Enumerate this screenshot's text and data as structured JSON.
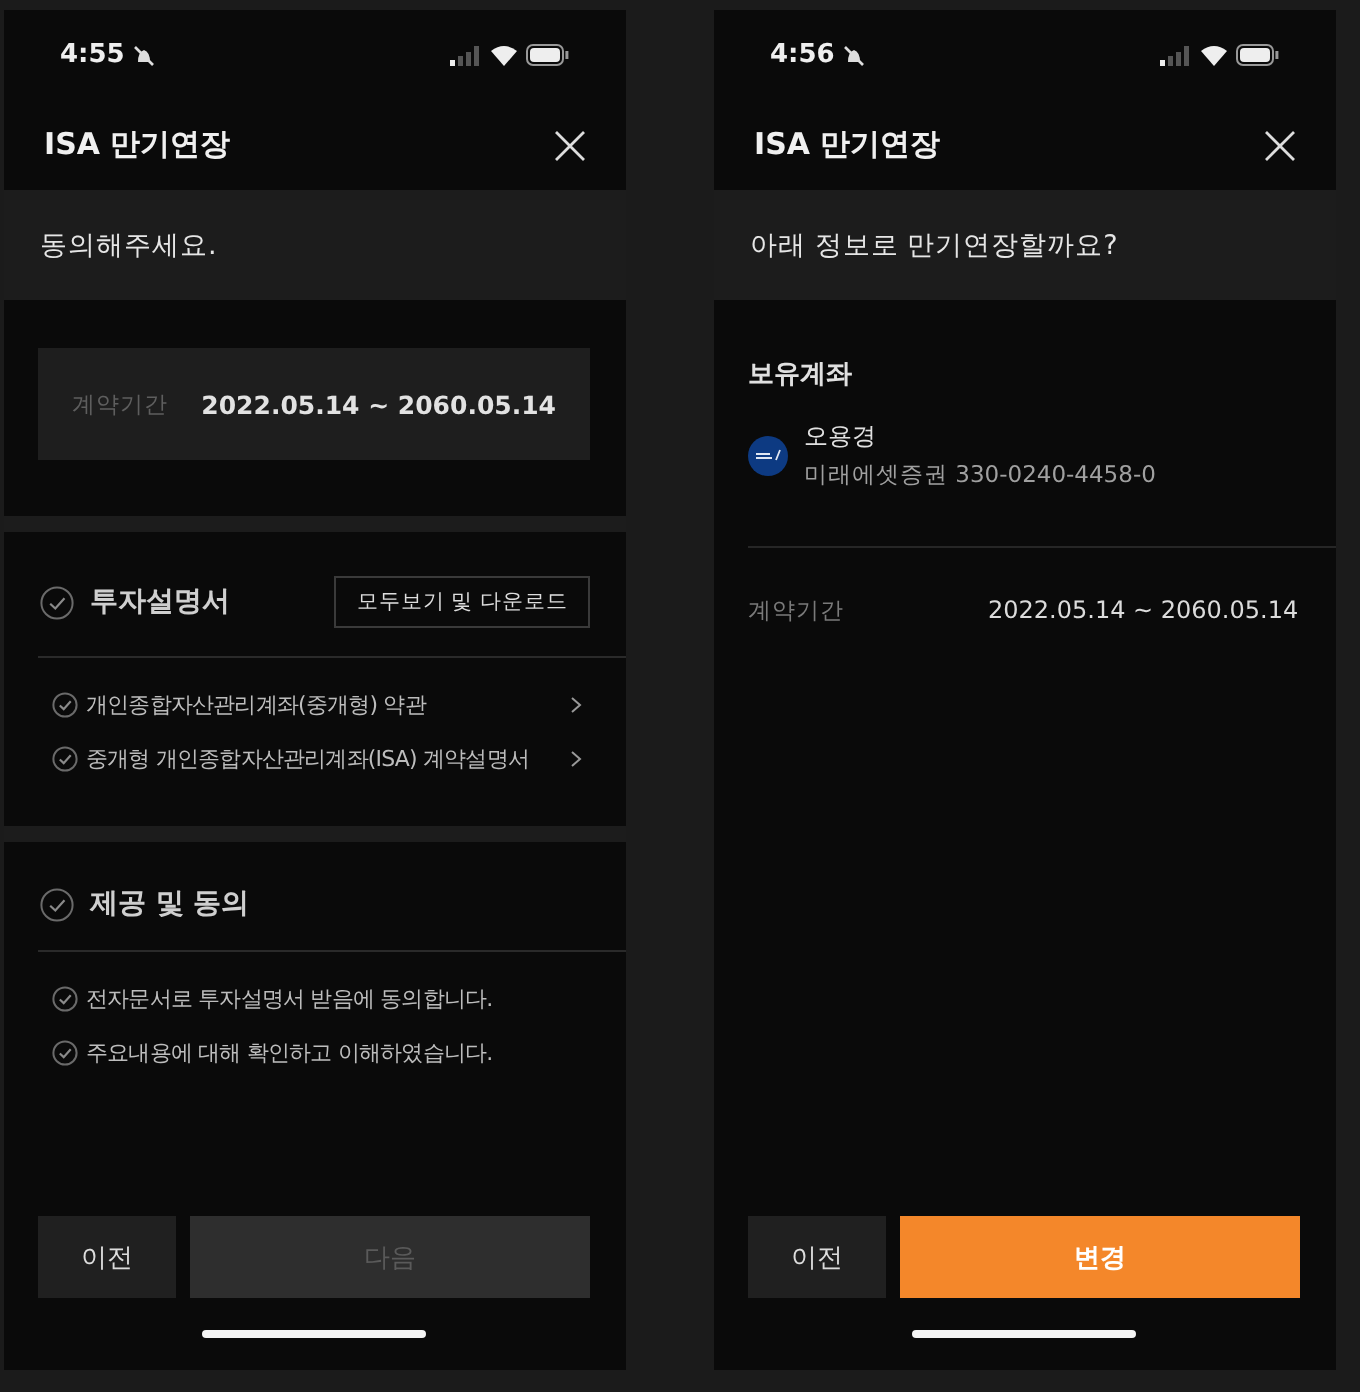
{
  "screens": [
    {
      "status_bar": {
        "time": "4:55"
      },
      "title": "ISA 만기연장",
      "prompt": "동의해주세요.",
      "sections": [
        {
          "kind": "period",
          "label": "계약기간",
          "value": "2022.05.14 ~ 2060.05.14"
        },
        {
          "kind": "agreement",
          "title": "투자설명서",
          "checked": false,
          "action": "모두보기 및 다운로드",
          "items": [
            {
              "label": "개인종합자산관리계좌(중개형) 약관",
              "checked": false,
              "has_detail": true
            },
            {
              "label": "중개형 개인종합자산관리계좌(ISA) 계약설명서",
              "checked": false,
              "has_detail": true
            }
          ]
        },
        {
          "kind": "agreement",
          "title": "제공 및 동의",
          "checked": false,
          "items": [
            {
              "label": "전자문서로 투자설명서 받음에 동의합니다.",
              "checked": false,
              "has_detail": false
            },
            {
              "label": "주요내용에 대해 확인하고 이해하였습니다.",
              "checked": false,
              "has_detail": false
            }
          ]
        }
      ],
      "buttons": [
        {
          "label": "이전",
          "kind": "secondary",
          "disabled": false
        },
        {
          "label": "다음",
          "kind": "primary",
          "disabled": true
        }
      ]
    },
    {
      "status_bar": {
        "time": "4:56"
      },
      "title": "ISA 만기연장",
      "prompt": "아래 정보로 만기연장할까요?",
      "sections": [
        {
          "kind": "account",
          "heading": "보유계좌",
          "owner": "오용경",
          "account": "미래에셋증권 330-0240-4458-0",
          "period_label": "계약기간",
          "period_value": "2022.05.14 ~ 2060.05.14"
        }
      ],
      "buttons": [
        {
          "label": "이전",
          "kind": "secondary",
          "disabled": false
        },
        {
          "label": "변경",
          "kind": "primary",
          "disabled": false
        }
      ]
    }
  ]
}
